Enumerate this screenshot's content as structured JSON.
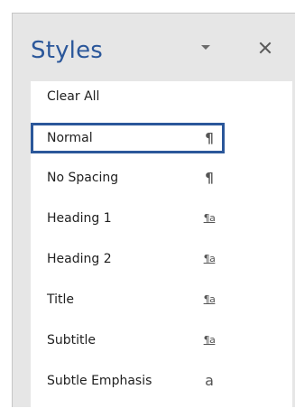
{
  "pane": {
    "title": "Styles"
  },
  "colors": {
    "accent": "#2b579a",
    "pane_bg": "#e6e6e6",
    "list_bg": "#ffffff"
  },
  "styles_list": {
    "items": [
      {
        "label": "Clear All",
        "icon": "none",
        "icon_text": "",
        "selected": false
      },
      {
        "label": "Normal",
        "icon": "paragraph-style-icon",
        "icon_text": "¶",
        "selected": true
      },
      {
        "label": "No Spacing",
        "icon": "paragraph-style-icon",
        "icon_text": "¶",
        "selected": false
      },
      {
        "label": "Heading 1",
        "icon": "linked-style-icon",
        "icon_text": "¶a",
        "selected": false
      },
      {
        "label": "Heading 2",
        "icon": "linked-style-icon",
        "icon_text": "¶a",
        "selected": false
      },
      {
        "label": "Title",
        "icon": "linked-style-icon",
        "icon_text": "¶a",
        "selected": false
      },
      {
        "label": "Subtitle",
        "icon": "linked-style-icon",
        "icon_text": "¶a",
        "selected": false
      },
      {
        "label": "Subtle Emphasis",
        "icon": "character-style-icon",
        "icon_text": "a",
        "selected": false
      }
    ]
  }
}
